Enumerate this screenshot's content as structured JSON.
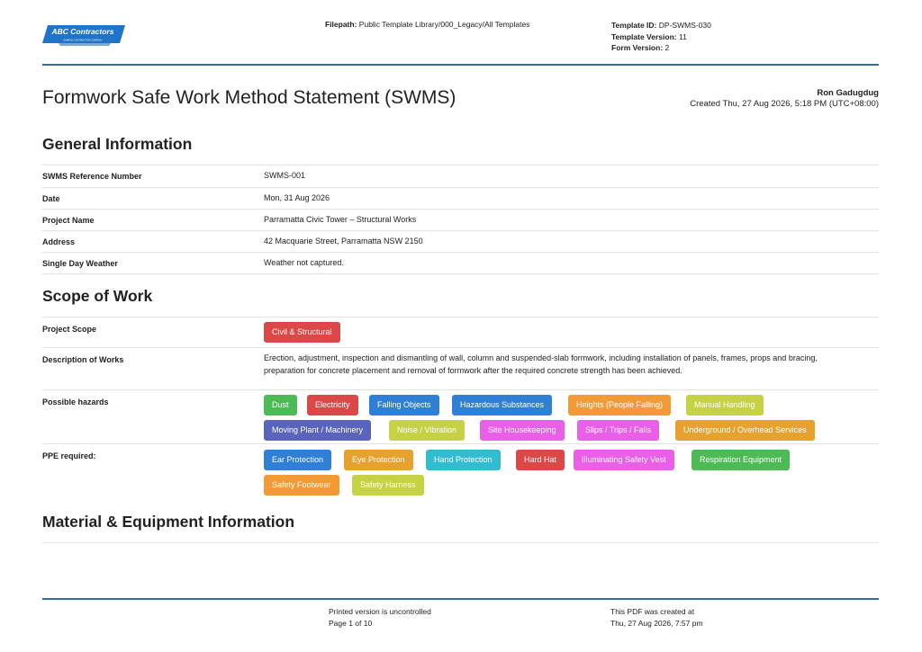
{
  "header": {
    "logo_text": "ABC Contractors",
    "logo_subtext": "SAMPLE CONTRACTOR COMPANY",
    "filepath_label": "Filepath:",
    "filepath_value": "Public Template Library/000_Legacy/All Templates",
    "template_id_label": "Template ID:",
    "template_id_value": "DP-SWMS-030",
    "template_version_label": "Template Version:",
    "template_version_value": "11",
    "form_version_label": "Form Version:",
    "form_version_value": "2",
    "accent_color": "#2f6fa8"
  },
  "document": {
    "title": "Formwork Safe Work Method Statement (SWMS)",
    "author": "Ron Gadugdug",
    "created": "Created Thu, 27 Aug 2026, 5:18 PM (UTC+08:00)"
  },
  "general": {
    "heading": "General Information",
    "rows": [
      {
        "label": "SWMS Reference Number",
        "value": "SWMS-001"
      },
      {
        "label": "Date",
        "value": "Mon, 31 Aug 2026"
      },
      {
        "label": "Project Name",
        "value": "Parramatta Civic Tower – Structural Works"
      },
      {
        "label": "Address",
        "value": "42 Macquarie Street, Parramatta NSW 2150"
      },
      {
        "label": "Single Day Weather",
        "value": "Weather not captured."
      }
    ]
  },
  "scope": {
    "heading": "Scope of Work",
    "project_scope_label": "Project Scope",
    "project_scope_tags": [
      {
        "label": "Civil & Structural",
        "color": "#dc4848"
      }
    ],
    "description_label": "Description of Works",
    "description_line1": "Erection, adjustment, inspection and dismantling of wall, column and suspended-slab formwork, including installation of panels, frames, props and bracing,",
    "description_line2": "preparation for concrete placement and removal of formwork after the required concrete strength has been achieved.",
    "hazards_label": "Possible hazards",
    "hazards": [
      {
        "label": "Dust",
        "color": "#4cba55"
      },
      {
        "label": "Electricity",
        "color": "#dc4848"
      },
      {
        "label": "Falling Objects",
        "color": "#2f7fd6"
      },
      {
        "label": "Hazardous Substances",
        "color": "#2f7fd6"
      },
      {
        "label": "Heights (People Falling)",
        "color": "#f29a36"
      },
      {
        "label": "Manual Handling",
        "color": "#c4d244"
      },
      {
        "label": "Moving Plant / Machinery",
        "color": "#5a64bd"
      },
      {
        "label": "Noise / Vibration",
        "color": "#c4d244"
      },
      {
        "label": "Site Housekeeping",
        "color": "#ea5ee8"
      },
      {
        "label": "Slips / Trips / Falls",
        "color": "#ea5ee8"
      },
      {
        "label": "Underground / Overhead Services",
        "color": "#e6a22d"
      }
    ],
    "ppe_label": "PPE required:",
    "ppe": [
      {
        "label": "Ear Protection",
        "color": "#2f7fd6"
      },
      {
        "label": "Eye Protection",
        "color": "#e6a22d"
      },
      {
        "label": "Hand Protection",
        "color": "#32bcd0"
      },
      {
        "label": "Hard Hat",
        "color": "#dc4848"
      },
      {
        "label": "Illuminating Safety Vest",
        "color": "#ea5ee8"
      },
      {
        "label": "Respiration Equipment",
        "color": "#4cba55"
      },
      {
        "label": "Safety Footwear",
        "color": "#f29a36"
      },
      {
        "label": "Safety Harness",
        "color": "#c4d244"
      }
    ]
  },
  "material": {
    "heading": "Material & Equipment Information"
  },
  "footer": {
    "uncontrolled": "Printed version is uncontrolled",
    "page": "Page 1 of 10",
    "pdf_created_label": "This PDF was created at",
    "pdf_created_value": "Thu, 27 Aug 2026, 7:57 pm"
  }
}
